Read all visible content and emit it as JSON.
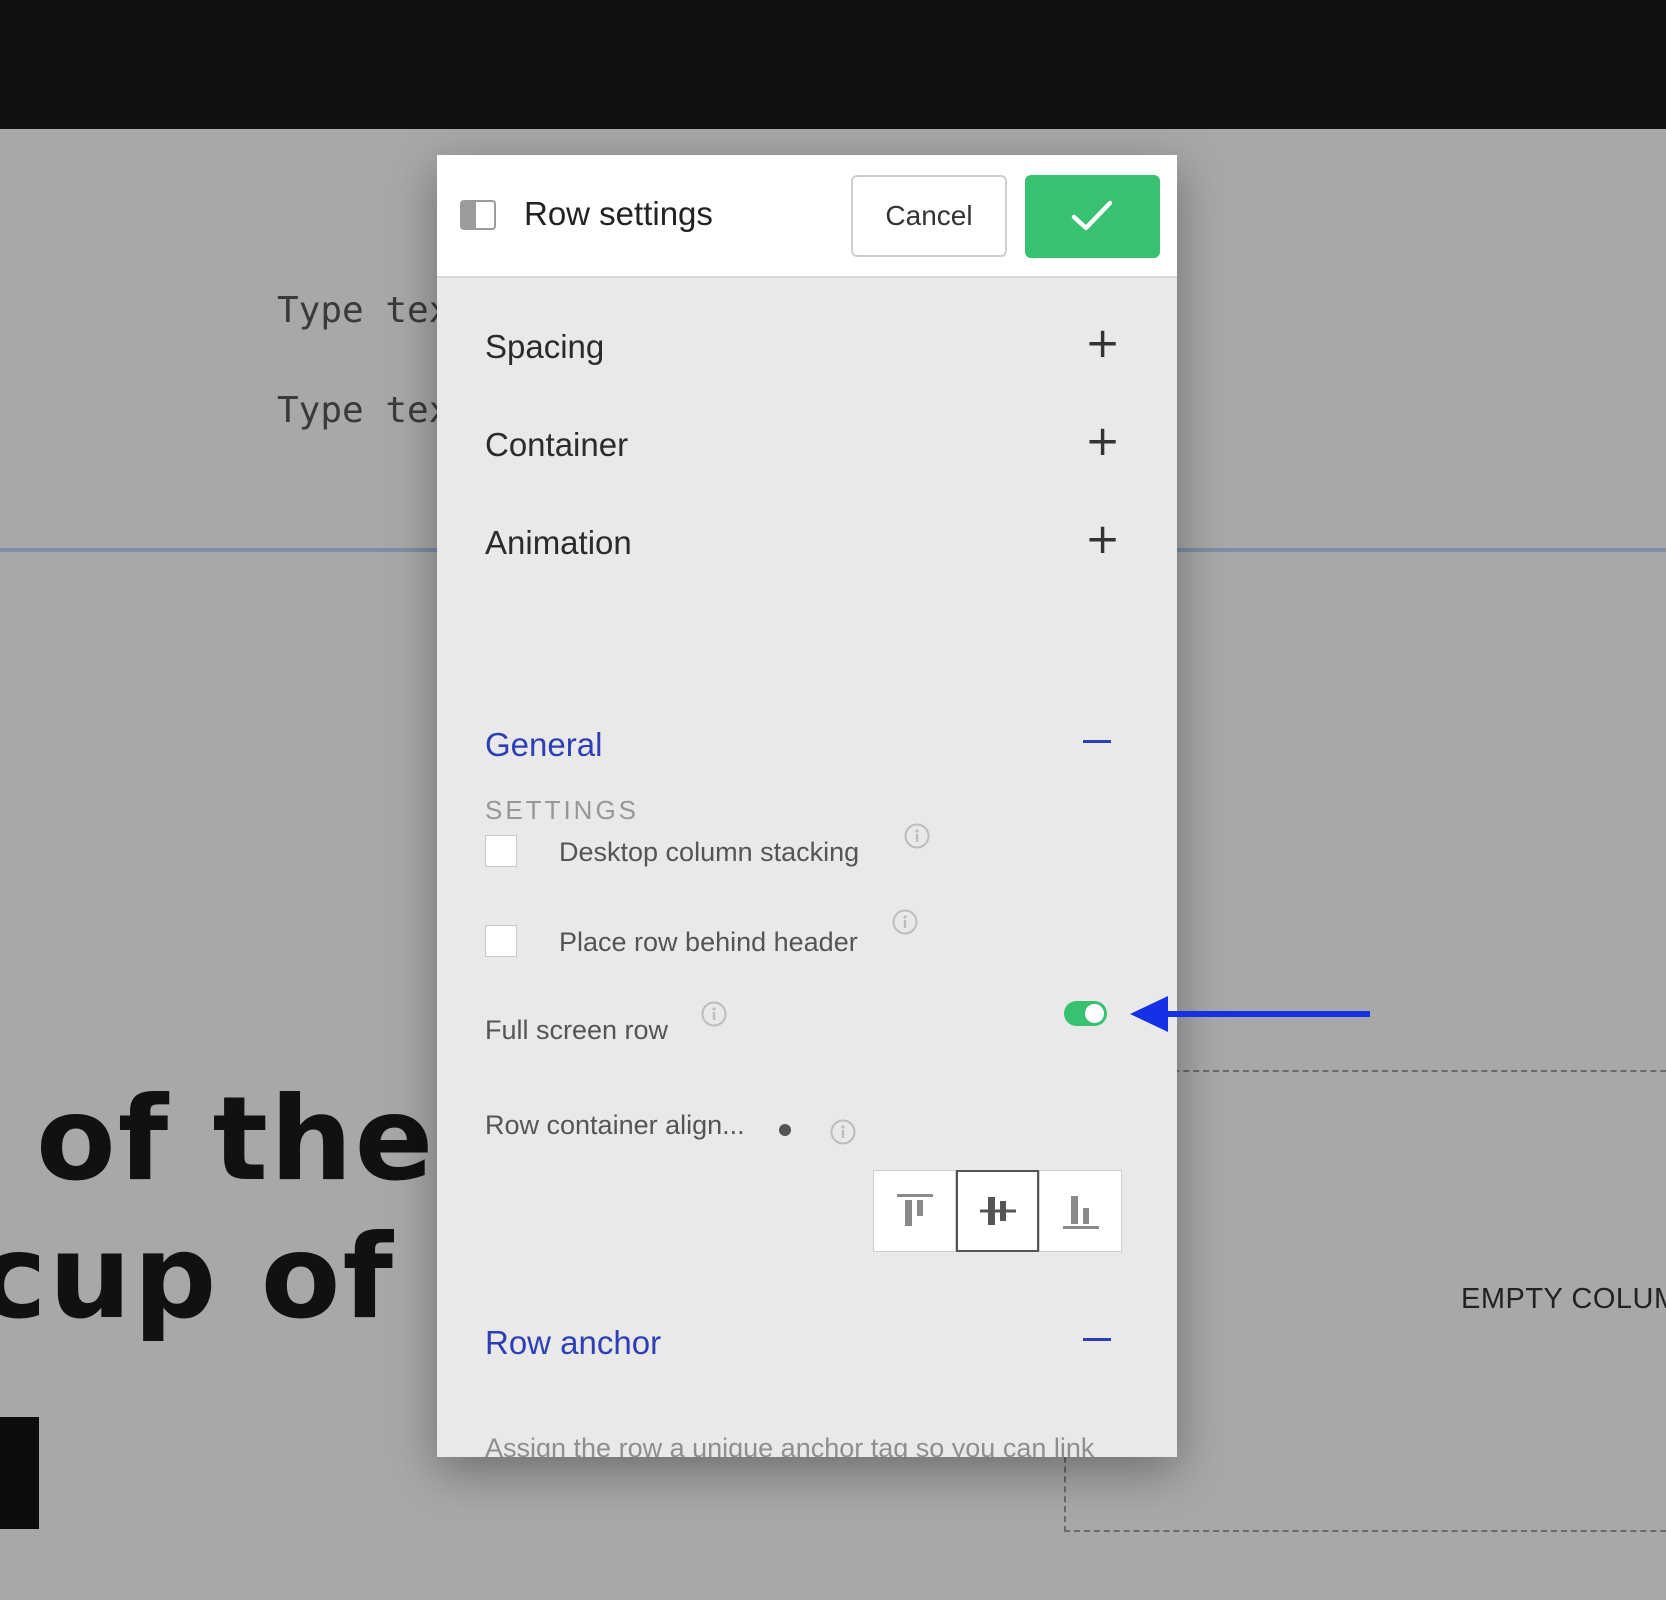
{
  "background": {
    "type_text_1": "Type tex",
    "type_text_2": "Type tex",
    "headline_line_1": "of the v",
    "headline_line_2": "cup of co",
    "empty_column": "EMPTY COLUMN"
  },
  "modal": {
    "title": "Row settings",
    "cancel_label": "Cancel",
    "confirm_icon": "check-icon",
    "accordions": [
      {
        "label": "Spacing",
        "icon": "+"
      },
      {
        "label": "Container",
        "icon": "+"
      },
      {
        "label": "Animation",
        "icon": "+"
      }
    ],
    "section_label": "SETTINGS",
    "general": {
      "title": "General",
      "desktop_stacking_label": "Desktop column stacking",
      "desktop_stacking_checked": false,
      "behind_header_label": "Place row behind header",
      "behind_header_checked": false,
      "full_screen_label": "Full screen row",
      "full_screen_enabled": true,
      "alignment_label": "Row container align...",
      "alignment_options": [
        "top",
        "middle",
        "bottom"
      ],
      "alignment_selected": "middle"
    },
    "row_anchor": {
      "title": "Row anchor",
      "description": "Assign the row a unique anchor tag so you can link"
    }
  },
  "colors": {
    "accent_green": "#37c170",
    "link_blue": "#2e3fb6",
    "annotation_arrow": "#1630e6"
  }
}
